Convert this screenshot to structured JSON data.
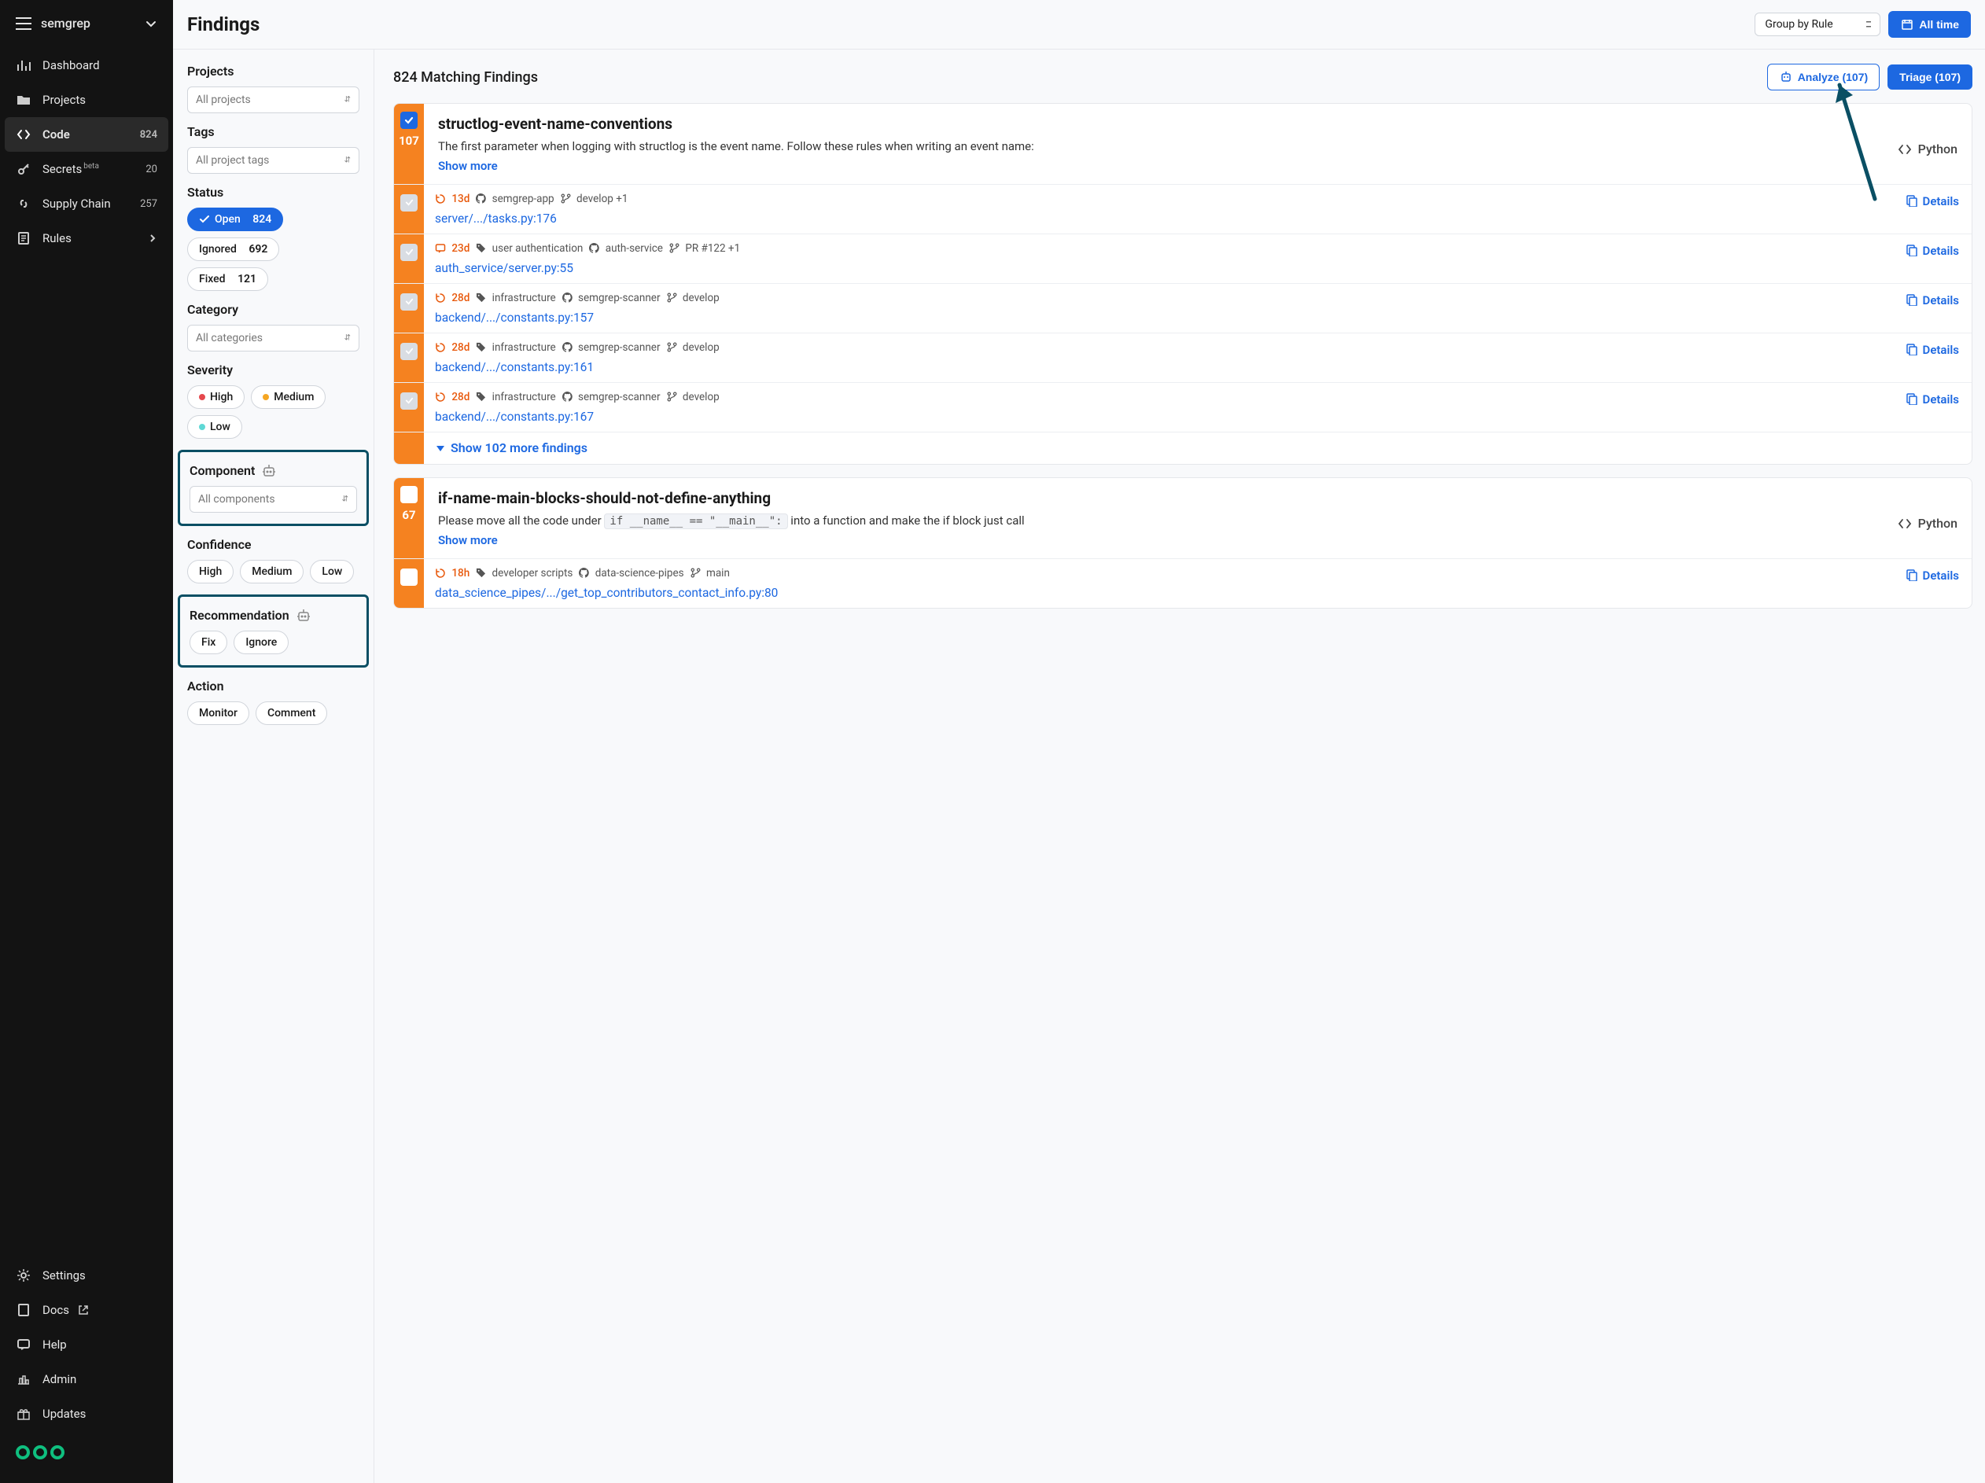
{
  "brand": "semgrep",
  "nav": {
    "dashboard": "Dashboard",
    "projects": "Projects",
    "code": "Code",
    "code_badge": "824",
    "secrets": "Secrets",
    "secrets_sup": "beta",
    "secrets_badge": "20",
    "supply": "Supply Chain",
    "supply_badge": "257",
    "rules": "Rules",
    "settings": "Settings",
    "docs": "Docs",
    "help": "Help",
    "admin": "Admin",
    "updates": "Updates"
  },
  "page_title": "Findings",
  "group_by": "Group by Rule",
  "all_time": "All time",
  "filters": {
    "projects_h": "Projects",
    "projects_ph": "All projects",
    "tags_h": "Tags",
    "tags_ph": "All project tags",
    "status_h": "Status",
    "status_open": "Open",
    "status_open_n": "824",
    "status_ignored": "Ignored",
    "status_ignored_n": "692",
    "status_fixed": "Fixed",
    "status_fixed_n": "121",
    "category_h": "Category",
    "category_ph": "All categories",
    "severity_h": "Severity",
    "sev_high": "High",
    "sev_med": "Medium",
    "sev_low": "Low",
    "component_h": "Component",
    "component_ph": "All components",
    "confidence_h": "Confidence",
    "conf_high": "High",
    "conf_med": "Medium",
    "conf_low": "Low",
    "recommendation_h": "Recommendation",
    "rec_fix": "Fix",
    "rec_ignore": "Ignore",
    "action_h": "Action",
    "act_monitor": "Monitor",
    "act_comment": "Comment"
  },
  "results": {
    "heading": "824 Matching Findings",
    "analyze": "Analyze (107)",
    "triage": "Triage (107)"
  },
  "rule1": {
    "count": "107",
    "title": "structlog-event-name-conventions",
    "desc": "The first parameter when logging with structlog is the event name. Follow these rules when writing an event name:",
    "show_more": "Show more",
    "lang": "Python",
    "findings": [
      {
        "age": "13d",
        "age_kind": "history",
        "t1": "semgrep-app",
        "t1i": "gh",
        "t2": "develop +1",
        "t2i": "branch",
        "path": "server/.../tasks.py:176"
      },
      {
        "age": "23d",
        "age_kind": "comment",
        "t1": "user authentication",
        "t1i": "tag",
        "t2": "auth-service",
        "t2i": "gh",
        "t3": "PR #122 +1",
        "t3i": "branch",
        "path": "auth_service/server.py:55"
      },
      {
        "age": "28d",
        "age_kind": "history",
        "t1": "infrastructure",
        "t1i": "tag",
        "t2": "semgrep-scanner",
        "t2i": "gh",
        "t3": "develop",
        "t3i": "branch",
        "path": "backend/.../constants.py:157"
      },
      {
        "age": "28d",
        "age_kind": "history",
        "t1": "infrastructure",
        "t1i": "tag",
        "t2": "semgrep-scanner",
        "t2i": "gh",
        "t3": "develop",
        "t3i": "branch",
        "path": "backend/.../constants.py:161"
      },
      {
        "age": "28d",
        "age_kind": "history",
        "t1": "infrastructure",
        "t1i": "tag",
        "t2": "semgrep-scanner",
        "t2i": "gh",
        "t3": "develop",
        "t3i": "branch",
        "path": "backend/.../constants.py:167"
      }
    ],
    "more": "Show 102 more findings"
  },
  "rule2": {
    "count": "67",
    "title": "if-name-main-blocks-should-not-define-anything",
    "desc_a": "Please move all the code under ",
    "desc_code": "if __name__ == \"__main__\":",
    "desc_b": " into a function and make the if block just call",
    "show_more": "Show more",
    "lang": "Python",
    "findings": [
      {
        "age": "18h",
        "age_kind": "history",
        "t1": "developer scripts",
        "t1i": "tag",
        "t2": "data-science-pipes",
        "t2i": "gh",
        "t3": "main",
        "t3i": "branch",
        "path": "data_science_pipes/.../get_top_contributors_contact_info.py:80"
      }
    ]
  },
  "details_label": "Details"
}
